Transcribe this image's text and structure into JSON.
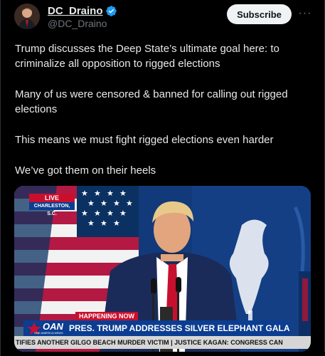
{
  "post": {
    "author": {
      "display_name": "DC_Draino",
      "handle": "@DC_Draino",
      "verified": true
    },
    "subscribe_label": "Subscribe",
    "more_label": "···",
    "text": {
      "p1": "Trump discusses the Deep State’s ultimate goal here: to criminalize all opposition to rigged elections",
      "p2": "Many of us were censored & banned for calling out rigged elections",
      "p3": "This means we must fight rigged elections even harder",
      "p4": "We’ve got them on their heels"
    }
  },
  "media": {
    "live_label": "LIVE",
    "location": "CHARLESTON, S.C.",
    "happening_now": "HAPPENING NOW",
    "network": "OAN",
    "network_sub": "ONE AMERICA NEWS",
    "headline": "PRES. TRUMP ADDRESSES SILVER ELEPHANT GALA",
    "ticker": "TIFIES ANOTHER GILGO BEACH MURDER VICTIM  |  JUSTICE KAGAN: CONGRESS CAN"
  },
  "colors": {
    "background": "#000000",
    "text": "#e7e9ea",
    "muted": "#71767b",
    "verified_blue": "#1d9bf0",
    "oan_blue": "#0b3d91",
    "oan_red": "#c8102e"
  }
}
